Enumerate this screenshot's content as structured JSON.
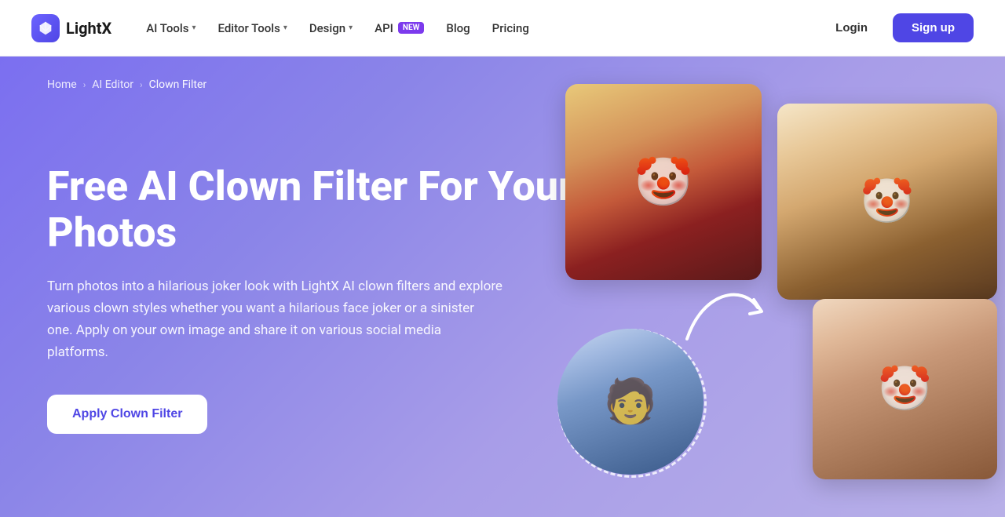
{
  "navbar": {
    "logo_text": "LightX",
    "nav_items": [
      {
        "label": "AI Tools",
        "has_dropdown": true,
        "id": "ai-tools"
      },
      {
        "label": "Editor Tools",
        "has_dropdown": true,
        "id": "editor-tools"
      },
      {
        "label": "Design",
        "has_dropdown": true,
        "id": "design"
      },
      {
        "label": "Blog",
        "has_dropdown": false,
        "id": "blog"
      },
      {
        "label": "Pricing",
        "has_dropdown": false,
        "id": "pricing"
      }
    ],
    "api_label": "API",
    "api_badge": "NEW",
    "login_label": "Login",
    "signup_label": "Sign up"
  },
  "breadcrumb": {
    "home": "Home",
    "ai_editor": "AI Editor",
    "current": "Clown Filter"
  },
  "hero": {
    "title": "Free AI Clown Filter For Your Photos",
    "description": "Turn photos into a hilarious joker look with LightX AI clown filters and explore various clown styles whether you want a hilarious face joker or a sinister one. Apply on your own image and share it on various social media platforms.",
    "cta_label": "Apply Clown Filter"
  },
  "colors": {
    "accent": "#4f46e5",
    "hero_bg_start": "#7b6ff0",
    "hero_bg_end": "#b8b0e8",
    "new_badge": "#7c3aed",
    "signup_bg": "#4f46e5"
  }
}
